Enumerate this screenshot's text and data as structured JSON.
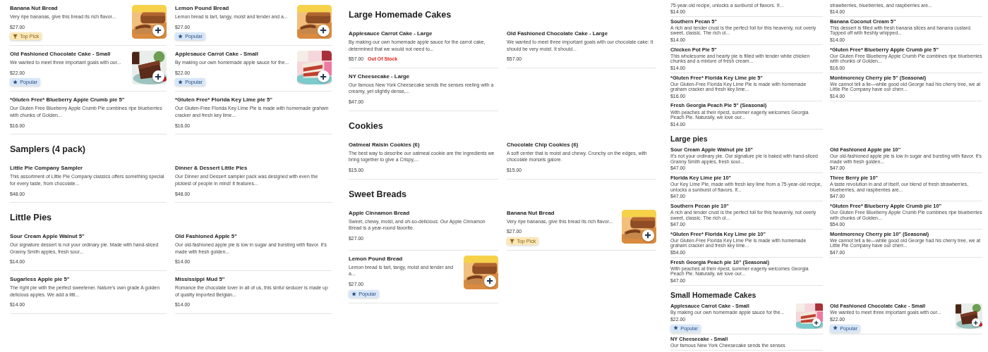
{
  "panels": [
    {
      "sections": [
        {
          "items": [
            {
              "title": "Banana Nut Bread",
              "description": "Very ripe bananas, give this bread its rich flavor...",
              "price": "$27.00",
              "badge": {
                "kind": "top_pick",
                "label": "Top Pick"
              }
            },
            {
              "title": "Lemon Pound Bread",
              "description": "Lemon bread is tart, tangy, moist and tender and a...",
              "price": "$27.00",
              "badge": {
                "kind": "popular",
                "label": "Popular"
              }
            },
            {
              "title": "Old Fashioned Chocolate Cake - Small",
              "description": "We wanted to meet three important goals with our...",
              "price": "$22.00",
              "badge": {
                "kind": "popular",
                "label": "Popular"
              }
            },
            {
              "title": "Applesauce Carrot Cake - Small",
              "description": "By making our own homemade apple sauce for the...",
              "price": "$22.00",
              "badge": {
                "kind": "popular",
                "label": "Popular"
              }
            },
            {
              "title": "*Gluten Free* Blueberry Apple Crumb pie 5\"",
              "description": "Our Gluten Free Blueberry Apple Crumb Pie combines ripe blueberries with chunks of Golden...",
              "price": "$16.00"
            },
            {
              "title": "*Gluten Free* Florida Key Lime pie 5\"",
              "description": "Our Gluten-Free Florida Key Lime Pie is made with homemade graham cracker and fresh key lime...",
              "price": "$16.00"
            }
          ]
        },
        {
          "heading": "Samplers (4 pack)",
          "items": [
            {
              "title": "Little Pie Company Sampler",
              "description": "This assortment of Little Pie Company classics offers something special for every taste, from chocolate...",
              "price": "$48.00"
            },
            {
              "title": "Dinner & Dessert Little Pies",
              "description": "Our Dinner and Dessert sampler pack was designed with even the pickiest of people in mind! It features...",
              "price": "$48.00"
            }
          ]
        },
        {
          "heading": "Little Pies",
          "items": [
            {
              "title": "Sour Cream Apple Walnut 5\"",
              "description": "Our signature dessert is not your ordinary pie. Made with hand-sliced Granny Smith apples, fresh sour...",
              "price": "$14.00"
            },
            {
              "title": "Old Fashioned Apple 5\"",
              "description": "Our old-fashioned apple pie is low in sugar and bursting with flavor. It's made with fresh golden...",
              "price": "$14.00"
            },
            {
              "title": "Sugarless Apple pie 5\"",
              "description": "The right pie with the perfect sweetener. Nature's own grade A golden delicious apples. We add a littl...",
              "price": "$14.00"
            },
            {
              "title": "Mississippi Mud 5\"",
              "description": "Romance the chocolate lover in all of us, this sinful seducer is made up of quality imported Belgian...",
              "price": "$14.00"
            }
          ]
        }
      ]
    },
    {
      "sections": [
        {
          "heading": "Large Homemade Cakes",
          "items": [
            {
              "title": "Applesauce Carrot Cake - Large",
              "description": "By making our own homemade apple sauce for the carrot cake, determined that we would not need to...",
              "price": "$57.00",
              "status": "Out Of Stock"
            },
            {
              "title": "Old Fashioned Chocolate Cake - Large",
              "description": "We wanted to meet three important goals with our chocolate cake: It should be very moist. It should...",
              "price": "$57.00"
            },
            {
              "title": "NY Cheesecake - Large",
              "description": "Our famous New York Cheesecake sends the senses reeling with a creamy, yet slightly dense,...",
              "price": "$47.00"
            }
          ]
        },
        {
          "heading": "Cookies",
          "items": [
            {
              "title": "Oatmeal Raisin Cookies (6)",
              "description": "The best way to describe our oatmeal cookie are the ingredients we bring together to give a Crispy,...",
              "price": "$15.00"
            },
            {
              "title": "Chocolate Chip Cookies (6)",
              "description": "A soft center that is moist and chewy. Crunchy on the edges, with chocolate morsels galore.",
              "price": "$15.00"
            }
          ]
        },
        {
          "heading": "Sweet Breads",
          "items": [
            {
              "title": "Apple Cinnamon Bread",
              "description": "Sweet, chewy, moist, and oh-so-delicious: Our Apple Cinnamon Bread is a year-round favorite.",
              "price": "$27.00"
            },
            {
              "title": "Banana Nut Bread",
              "description": "Very ripe bananas, give this bread its rich flavor...",
              "price": "$27.00",
              "badge": {
                "kind": "top_pick",
                "label": "Top Pick"
              }
            },
            {
              "title": "Lemon Pound Bread",
              "description": "Lemon bread is tart, tangy, moist and tender and a...",
              "price": "$27.00",
              "badge": {
                "kind": "popular",
                "label": "Popular"
              }
            }
          ]
        }
      ]
    },
    {
      "sections": [
        {
          "items": [
            {
              "description": "75-year-old recipe, unlocks a sunburst of flavors. If...",
              "price": "$14.00"
            },
            {
              "description": "strawberries, blueberries, and raspberries are...",
              "price": "$14.00"
            },
            {
              "title": "Southern Pecan 5\"",
              "description": "A rich and tender crust is the perfect foil for this heavenly, not overly sweet, classic. The rich ol...",
              "price": "$14.00"
            },
            {
              "title": "Banana Coconut Cream 5\"",
              "description": "This dessert is filled with fresh banana slices and banana custard. Topped off with freshly whipped...",
              "price": "$14.00"
            },
            {
              "title": "Chicken Pot Pie 5\"",
              "description": "This wholesome and hearty pie is filled with tender white chicken chunks and a mixture of fresh cream...",
              "price": "$14.00"
            },
            {
              "title": "*Gluten Free* Blueberry Apple Crumb pie 5\"",
              "description": "Our Gluten Free Blueberry Apple Crumb Pie combines ripe blueberries with chunks of Golden...",
              "price": "$16.00"
            },
            {
              "title": "*Gluten Free* Florida Key Lime pie 5\"",
              "description": "Our Gluten-Free Florida Key Lime Pie is made with homemade graham cracker and fresh key lime...",
              "price": "$16.00"
            },
            {
              "title": "Montmorency Cherry pie 5\" (Seasonal)",
              "description": "We cannot tell a lie—while good old George had his cherry tree, we at Little Pie Company have our cherr...",
              "price": "$14.00"
            },
            {
              "title": "Fresh Georgia Peach Pie 5\" (Seasonal)",
              "description": "With peaches at their ripest, summer eagerly welcomes Georgia Peach Pie. Naturally, we love our...",
              "price": "$14.00"
            }
          ]
        },
        {
          "heading": "Large pies",
          "items": [
            {
              "title": "Sour Cream Apple Walnut pie 10\"",
              "description": "It's not your ordinary pie. Our signature pie is baked with hand-sliced Granny Smith apples, fresh sour...",
              "price": "$47.00"
            },
            {
              "title": "Old Fashioned Apple pie 10\"",
              "description": "Our old-fashioned apple pie is low in sugar and bursting with flavor. It's made with fresh golden...",
              "price": "$47.00"
            },
            {
              "title": "Florida Key Lime pie 10\"",
              "description": "Our Key Lime Pie, made with fresh key lime from a 75-year-old recipe, unlocks a sunburst of flavors. If...",
              "price": "$47.00"
            },
            {
              "title": "Three Berry pie 10\"",
              "description": "A taste revolution in and of itself, our blend of fresh strawberries, blueberries, and raspberries are...",
              "price": "$47.00"
            },
            {
              "title": "Southern Pecan pie 10\"",
              "description": "A rich and tender crust is the perfect foil for this heavenly, not overly sweet, classic. The rich ol...",
              "price": "$47.00"
            },
            {
              "title": "*Gluten Free* Blueberry Apple Crumb pie 10\"",
              "description": "Our Gluten Free Blueberry Apple Crumb Pie combines ripe blueberries with chunks of Golden...",
              "price": "$54.00"
            },
            {
              "title": "*Gluten Free* Florida Key Lime pie 10\"",
              "description": "Our Gluten-Free Florida Key Lime Pie is made with homemade graham cracker and fresh key lime...",
              "price": "$54.00"
            },
            {
              "title": "Montmorency Cherry pie 10\" (Seasonal)",
              "description": "We cannot tell a lie—while good old George had his cherry tree, we at Little Pie Company have our cherr...",
              "price": "$47.00"
            },
            {
              "title": "Fresh Georgia Peach pie 10\" (Seasonal)",
              "description": "With peaches at their ripest, summer eagerly welcomes Georgia Peach Pie. Naturally, we love our...",
              "price": "$47.00"
            }
          ]
        },
        {
          "heading": "Small Homemade Cakes",
          "items": [
            {
              "title": "Applesauce Carrot Cake - Small",
              "description": "By making our own homemade apple sauce for the...",
              "price": "$22.00",
              "badge": {
                "kind": "popular",
                "label": "Popular"
              }
            },
            {
              "title": "Old Fashioned Chocolate Cake - Small",
              "description": "We wanted to meet three important goals with our...",
              "price": "$22.00",
              "badge": {
                "kind": "popular",
                "label": "Popular"
              }
            },
            {
              "title": "NY Cheesecake - Small",
              "description": "Our famous New York Cheesecake sends the senses"
            }
          ]
        }
      ]
    }
  ]
}
